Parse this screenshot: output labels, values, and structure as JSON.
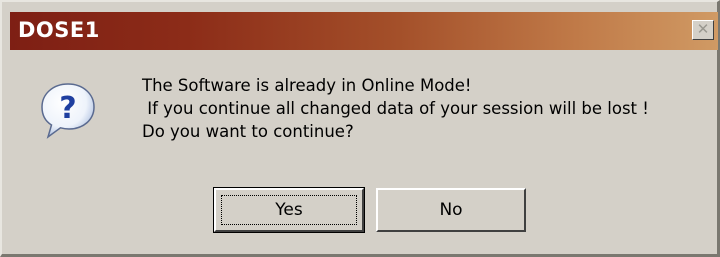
{
  "window": {
    "title": "DOSE1",
    "close_glyph": "✕"
  },
  "dialog": {
    "icon": "question-icon",
    "message_lines": [
      "The Software is already in Online Mode!",
      " If you continue all changed data of your session will be lost !",
      "Do you want to continue?"
    ]
  },
  "buttons": {
    "yes_label": "Yes",
    "no_label": "No"
  },
  "colors": {
    "titlebar_start": "#7e1f14",
    "titlebar_end": "#d09a64",
    "dialog_background": "#d4d0c8",
    "icon_bubble": "#ffffff",
    "icon_glyph": "#1f3fa0"
  }
}
